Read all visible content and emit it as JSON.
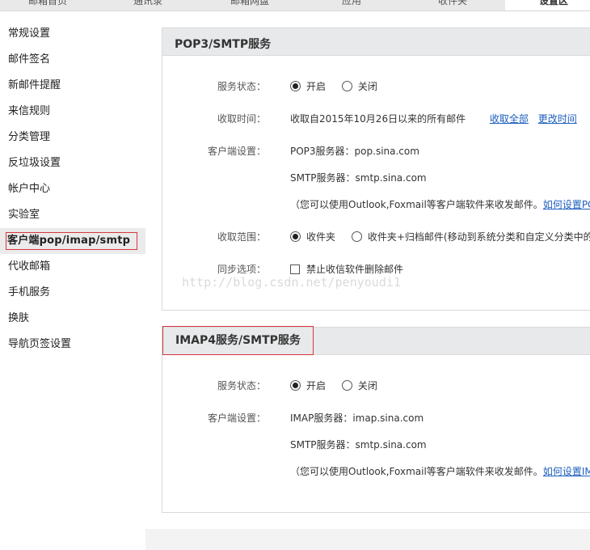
{
  "top_tabs": [
    {
      "label": "邮箱首页"
    },
    {
      "label": "通讯录"
    },
    {
      "label": "邮箱网盘"
    },
    {
      "label": "应用"
    },
    {
      "label": "收件夹"
    },
    {
      "label": "设置区"
    }
  ],
  "sidebar": {
    "items": [
      {
        "label": "常规设置"
      },
      {
        "label": "邮件签名"
      },
      {
        "label": "新邮件提醒"
      },
      {
        "label": "来信规则"
      },
      {
        "label": "分类管理"
      },
      {
        "label": "反垃圾设置"
      },
      {
        "label": "帐户中心"
      },
      {
        "label": "实验室"
      },
      {
        "label": "客户端pop/imap/smtp",
        "active": true
      },
      {
        "label": "代收邮箱"
      },
      {
        "label": "手机服务"
      },
      {
        "label": "换肤"
      },
      {
        "label": "导航页签设置"
      }
    ]
  },
  "pop_panel": {
    "title": "POP3/SMTP服务",
    "status_label": "服务状态：",
    "status_on": "开启",
    "status_off": "关闭",
    "fetch_label": "收取时间：",
    "fetch_text": "收取自2015年10月26日以来的所有邮件",
    "fetch_all_link": "收取全部",
    "change_time_link": "更改时间",
    "client_label": "客户端设置：",
    "pop_server": "POP3服务器：pop.sina.com",
    "smtp_server": "SMTP服务器：smtp.sina.com",
    "hint": "（您可以使用Outlook,Foxmail等客户端软件来收发邮件。",
    "hint_link": "如何设置PC",
    "range_label": "收取范围：",
    "range_inbox": "收件夹",
    "range_more": "收件夹+归档邮件(移动到系统分类和自定义分类中的",
    "sync_label": "同步选项：",
    "sync_option": "禁止收信软件删除邮件"
  },
  "imap_panel": {
    "title": "IMAP4服务/SMTP服务",
    "status_label": "服务状态：",
    "status_on": "开启",
    "status_off": "关闭",
    "client_label": "客户端设置：",
    "imap_server": "IMAP服务器：imap.sina.com",
    "smtp_server": "SMTP服务器：smtp.sina.com",
    "hint": "（您可以使用Outlook,Foxmail等客户端软件来收发邮件。",
    "hint_link": "如何设置IM"
  },
  "watermark": "http://blog.csdn.net/penyoudi1"
}
